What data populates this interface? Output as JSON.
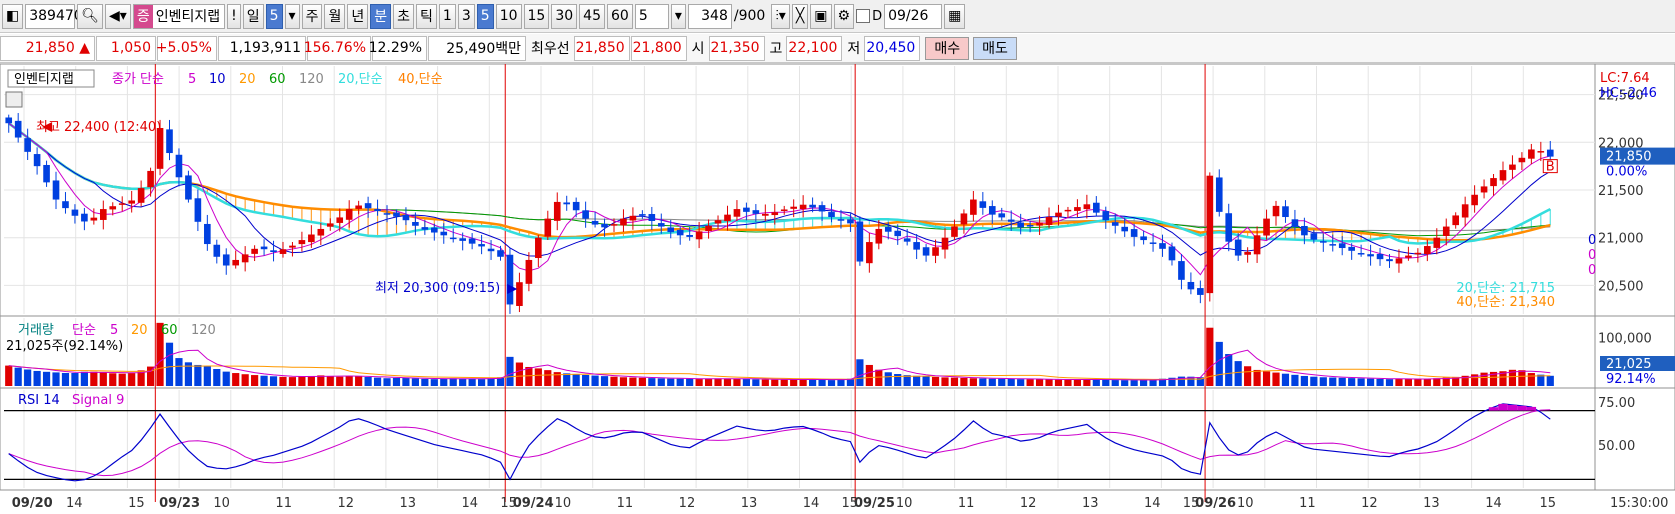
{
  "toolbar": {
    "stock_code": "389470",
    "name_tag": "증",
    "stock_name": "인벤티지랩",
    "alert": "!",
    "period_day": "일",
    "period_value": "5",
    "periods": [
      "주",
      "월",
      "년"
    ],
    "minute": "분",
    "second": "초",
    "tick": "틱",
    "intervals": [
      "1",
      "3",
      "5",
      "10",
      "15",
      "30",
      "45",
      "60"
    ],
    "selected_interval": "5",
    "count_value": "5",
    "bar_count": "348",
    "bar_total": "/900",
    "d_label": "D",
    "date": "09/26"
  },
  "quote": {
    "price": "21,850",
    "change_arrow": "▲",
    "change": "1,050",
    "change_pct": "+5.05%",
    "volume": "1,193,911",
    "volume_ratio": "156.76%",
    "turnover": "12.29%",
    "amount": "25,490백만",
    "best_label": "최우선",
    "ask": "21,850",
    "bid": "21,800",
    "open_label": "시",
    "open": "21,350",
    "high_label": "고",
    "high": "22,100",
    "low_label": "저",
    "low": "20,450",
    "buy_label": "매수",
    "sell_label": "매도"
  },
  "chart_data": [
    {
      "type": "candlestick",
      "legend": {
        "name": "인벤티지랩",
        "series_label": "종가 단순",
        "periods": [
          "5",
          "10",
          "20",
          "60",
          "120"
        ],
        "period_colors": [
          "#cc00cc",
          "#0000cc",
          "#ff9900",
          "#009900",
          "#888888"
        ],
        "extra": [
          "20,단순",
          "40,단순"
        ],
        "extra_colors": [
          "#33dddd",
          "#ff8000"
        ]
      },
      "y_ticks": [
        22500,
        22000,
        21500,
        21000,
        20500
      ],
      "y_tick_labels": [
        "22,500",
        "22,000",
        "21,500",
        "21,000",
        "20,500"
      ],
      "ylim": [
        20200,
        22800
      ],
      "corner_labels": [
        "LC:7.64",
        "HC:-2.46"
      ],
      "current_price": 21850,
      "current_label": "21,850",
      "change_label": "0.00%",
      "high_annotation": "최고 22,400 (12:40)",
      "low_annotation": "최저 20,300 (09:15)",
      "zero_labels": [
        "0",
        "0",
        "0"
      ],
      "ma20_label": "20,단순: 21,715",
      "ma40_label": "40,단순: 21,340",
      "sessions": [
        {
          "date": "09/20",
          "close": [
            22200,
            21950,
            21700,
            21400,
            21250,
            21150,
            21300,
            21350,
            21400,
            21700
          ]
        },
        {
          "date": "09/23",
          "close": [
            22150,
            21700,
            21300,
            20900,
            20700,
            20800,
            20900,
            20850,
            20900,
            21000,
            21100,
            21200,
            21350,
            21300,
            21250,
            21200,
            21100,
            21050,
            21000,
            20950,
            20900,
            20800
          ]
        },
        {
          "date": "09/24",
          "close": [
            20300,
            20700,
            21100,
            21400,
            21300,
            21150,
            21100,
            21200,
            21250,
            21150,
            21050,
            21000,
            21100,
            21200,
            21300,
            21250,
            21250,
            21300,
            21350,
            21300,
            21200,
            21150
          ]
        },
        {
          "date": "09/25",
          "close": [
            20750,
            21100,
            21050,
            20950,
            20800,
            20950,
            21150,
            21400,
            21250,
            21200,
            21100,
            21150,
            21250,
            21300,
            21350,
            21200,
            21100,
            21000,
            20950,
            20850,
            20500,
            20400
          ]
        },
        {
          "date": "09/26",
          "close": [
            21650,
            21000,
            20750,
            21050,
            21350,
            21150,
            21000,
            20950,
            20900,
            20850,
            20800,
            20750,
            20800,
            20850,
            21000,
            21200,
            21400,
            21550,
            21700,
            21800,
            21950,
            21850
          ]
        }
      ]
    },
    {
      "type": "bar",
      "legend": {
        "name": "거래량",
        "series_label": "단순",
        "periods": [
          "5",
          "20",
          "60",
          "120"
        ],
        "period_colors": [
          "#cc00cc",
          "#ff9900",
          "#009900",
          "#888888"
        ]
      },
      "current_volume_label": "21,025주(92.14%)",
      "y_tick_labels": [
        "100,000"
      ],
      "y_ticks": [
        100000
      ],
      "ylim": [
        0,
        140000
      ],
      "current_label": "21,025",
      "pct_label": "92.14%",
      "sessions": [
        {
          "date": "09/20",
          "values": [
            42000,
            35000,
            30000,
            28000,
            26000,
            30000,
            28000,
            25000,
            27000,
            40000
          ]
        },
        {
          "date": "09/23",
          "values": [
            130000,
            60000,
            45000,
            40000,
            30000,
            25000,
            22000,
            20000,
            18000,
            20000,
            22000,
            19000,
            21000,
            18000,
            16000,
            17000,
            15000,
            14000,
            16000,
            15000,
            14000,
            18000
          ]
        },
        {
          "date": "09/24",
          "values": [
            60000,
            40000,
            35000,
            28000,
            24000,
            22000,
            20000,
            18000,
            17000,
            16000,
            15000,
            15000,
            14000,
            16000,
            15000,
            14000,
            13000,
            13000,
            14000,
            13000,
            12000,
            15000
          ]
        },
        {
          "date": "09/25",
          "values": [
            55000,
            35000,
            26000,
            22000,
            20000,
            18000,
            17000,
            16000,
            15000,
            15000,
            14000,
            14000,
            13000,
            13000,
            14000,
            13000,
            12000,
            12000,
            13000,
            16000,
            20000,
            18000
          ]
        },
        {
          "date": "09/26",
          "values": [
            120000,
            70000,
            45000,
            32000,
            28000,
            24000,
            20000,
            18000,
            17000,
            16000,
            15000,
            14000,
            15000,
            14000,
            16000,
            18000,
            22000,
            28000,
            30000,
            35000,
            25000,
            21025
          ]
        }
      ]
    },
    {
      "type": "line",
      "legend": {
        "name": "RSI 14",
        "signal": "Signal 9",
        "colors": [
          "#0000cc",
          "#cc00cc"
        ]
      },
      "y_ticks": [
        75,
        50
      ],
      "y_tick_labels": [
        "75.00",
        "50.00"
      ],
      "ylim": [
        25,
        82
      ],
      "reference_lines": [
        70,
        30
      ],
      "sessions": [
        {
          "date": "09/20",
          "rsi": [
            45,
            38,
            33,
            31,
            29,
            30,
            35,
            42,
            48,
            60
          ]
        },
        {
          "date": "09/23",
          "rsi": [
            68,
            55,
            44,
            37,
            36,
            38,
            42,
            44,
            47,
            50,
            55,
            60,
            66,
            63,
            59,
            56,
            53,
            50,
            48,
            46,
            44,
            40
          ]
        },
        {
          "date": "09/24",
          "rsi": [
            30,
            48,
            58,
            66,
            60,
            55,
            54,
            57,
            58,
            54,
            50,
            48,
            53,
            57,
            61,
            59,
            58,
            60,
            61,
            58,
            54,
            52
          ]
        },
        {
          "date": "09/25",
          "rsi": [
            40,
            50,
            48,
            45,
            42,
            48,
            55,
            64,
            57,
            55,
            52,
            54,
            58,
            60,
            62,
            55,
            50,
            47,
            45,
            43,
            35,
            33
          ]
        },
        {
          "date": "09/26",
          "rsi": [
            63,
            48,
            43,
            52,
            58,
            53,
            48,
            47,
            46,
            45,
            44,
            43,
            46,
            48,
            52,
            58,
            65,
            70,
            74,
            73,
            72,
            65
          ]
        }
      ]
    }
  ],
  "x_axis": {
    "labels": [
      {
        "text": "09/20",
        "bold": true,
        "idx": 0.5
      },
      {
        "text": "14",
        "bold": false,
        "idx": 4
      },
      {
        "text": "15",
        "bold": false,
        "idx": 8
      },
      {
        "text": "09/23",
        "bold": true,
        "idx": 10
      },
      {
        "text": "10",
        "bold": false,
        "idx": 13.5
      },
      {
        "text": "11",
        "bold": false,
        "idx": 17.5
      },
      {
        "text": "12",
        "bold": false,
        "idx": 21.5
      },
      {
        "text": "13",
        "bold": false,
        "idx": 25.5
      },
      {
        "text": "14",
        "bold": false,
        "idx": 29.5
      },
      {
        "text": "15",
        "bold": false,
        "idx": 32
      },
      {
        "text": "09/24",
        "bold": true,
        "idx": 32.8
      },
      {
        "text": "10",
        "bold": false,
        "idx": 35.5
      },
      {
        "text": "11",
        "bold": false,
        "idx": 39.5
      },
      {
        "text": "12",
        "bold": false,
        "idx": 43.5
      },
      {
        "text": "13",
        "bold": false,
        "idx": 47.5
      },
      {
        "text": "14",
        "bold": false,
        "idx": 51.5
      },
      {
        "text": "15",
        "bold": false,
        "idx": 54
      },
      {
        "text": "09/25",
        "bold": true,
        "idx": 54.8
      },
      {
        "text": "10",
        "bold": false,
        "idx": 57.5
      },
      {
        "text": "11",
        "bold": false,
        "idx": 61.5
      },
      {
        "text": "12",
        "bold": false,
        "idx": 65.5
      },
      {
        "text": "13",
        "bold": false,
        "idx": 69.5
      },
      {
        "text": "14",
        "bold": false,
        "idx": 73.5
      },
      {
        "text": "15",
        "bold": false,
        "idx": 76
      },
      {
        "text": "09/26",
        "bold": true,
        "idx": 76.8
      },
      {
        "text": "10",
        "bold": false,
        "idx": 79.5
      },
      {
        "text": "11",
        "bold": false,
        "idx": 83.5
      },
      {
        "text": "12",
        "bold": false,
        "idx": 87.5
      },
      {
        "text": "13",
        "bold": false,
        "idx": 91.5
      },
      {
        "text": "14",
        "bold": false,
        "idx": 95.5
      },
      {
        "text": "15",
        "bold": false,
        "idx": 99
      }
    ],
    "time_label": "15:30:00"
  },
  "colors": {
    "up": "#e00000",
    "down": "#0040e0",
    "session_line": "#e00000",
    "ma_fill": "#ff8c00",
    "ma_cyan": "#33dddd"
  }
}
